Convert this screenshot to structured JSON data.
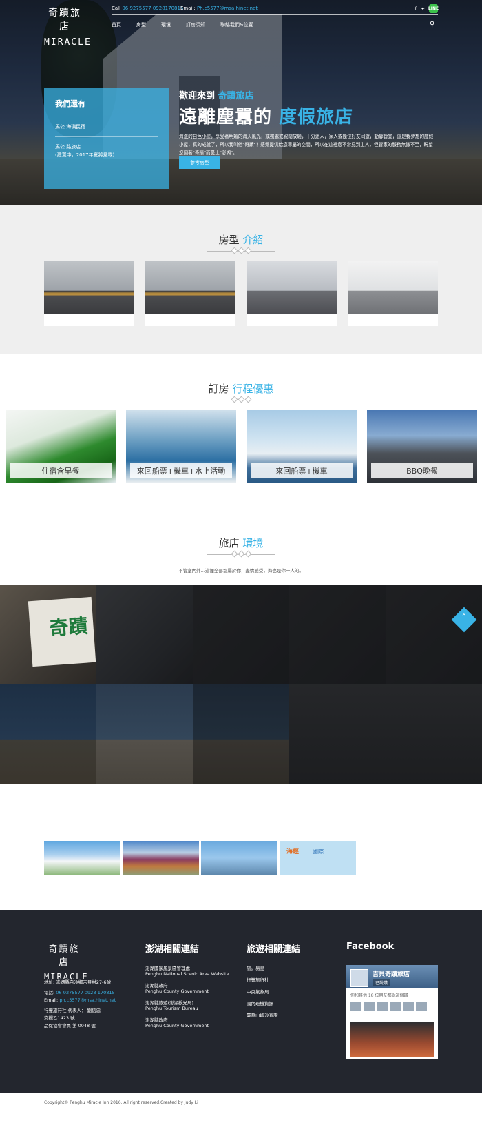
{
  "header": {
    "logo_cn": "奇蹟旅店",
    "logo_en": "MIRACLE",
    "call_label": "Call",
    "call_numbers": "06 9275577 0928170815",
    "email_label": "Email:",
    "email_value": "Ph.c5577@msa.hinet.net",
    "nav": [
      "首頁",
      "房型",
      "環境",
      "訂房須知",
      "聯絡我們&位置"
    ]
  },
  "hero": {
    "panel_title": "我們還有",
    "panel_items": [
      "馬公 海璵民宿",
      "馬公 路旅店\n(建置中，2017年夏將見載)"
    ],
    "welcome_prefix": "歡迎來到",
    "welcome_name": "奇蹟旅店",
    "headline_a": "遠離塵囂的",
    "headline_b": "度假旅店",
    "description": "海邊的自色小屋，享受著明媚的海天風光，或獨處或親闊放鬆，十分迷人，家人或幾位好友同遊，動靜皆宜，這是我夢想的度假小屋，真的成就了，所以我叫他\"奇蹟\"！感覺提供給您專屬的空間，所以在這裡您不常見到主人，但管家的服務無微不至，盼望您因著\"奇蹟\"而愛上\"澎湖\"。",
    "button": "參考房型"
  },
  "rooms": {
    "title_a": "房型",
    "title_b": "介紹"
  },
  "deals": {
    "title_a": "訂房",
    "title_b": "行程優惠",
    "items": [
      "住宿含早餐",
      "來回船票+機車+水上活動",
      "來回船票+機車",
      "BBQ晚餐"
    ]
  },
  "environment": {
    "title_a": "旅店",
    "title_b": "環境",
    "subtitle": "不管室內外...這裡全部都屬於你，盡情感受，海也是你一人的。",
    "sign_text": "奇蹟"
  },
  "partners": {
    "p4_text_a": "海經",
    "p4_text_b": "國際"
  },
  "footer": {
    "logo_cn": "奇蹟旅店",
    "logo_en": "MIRACLE",
    "address": "地址: 澎湖縣白沙鄉吉貝村27-6號",
    "phone_label": "電話:",
    "phone_value": "06-9275577 0928-170815",
    "email_label": "Email:",
    "email_value": "ph.c5577@msa.hinet.net",
    "agency": "行豐旅行社 代表人： 劉信忠",
    "agency_reg": "交觀乙1423 號",
    "agency_assoc": "品保協會會員 第 0048 號",
    "col1_title": "澎湖相關連結",
    "col1_links": [
      "澎湖國家風景區管理處\nPenghu National Scenic Area Website",
      "澎湖縣政府\nPenghu County Government",
      "澎湖縣旅遊(澎湖觀光局)\nPenghu Tourism Bureau",
      "澎湖縣政府\nPenghu County Government"
    ],
    "col2_title": "旅遊相關連結",
    "col2_links": [
      "旅。易島",
      "行豐旅行社",
      "中央氣象局",
      "國內班機資訊",
      "臺華山嶼沙查詢"
    ],
    "col3_title": "Facebook",
    "fb_page_name": "吉貝奇蹟旅店",
    "fb_like": "已說讚",
    "fb_friends": "你和其他 18 位朋友都說這個讚"
  },
  "copyright": "Copyright© Penghu Miracle Inn 2016. All right reserved.Created by Judy Li"
}
